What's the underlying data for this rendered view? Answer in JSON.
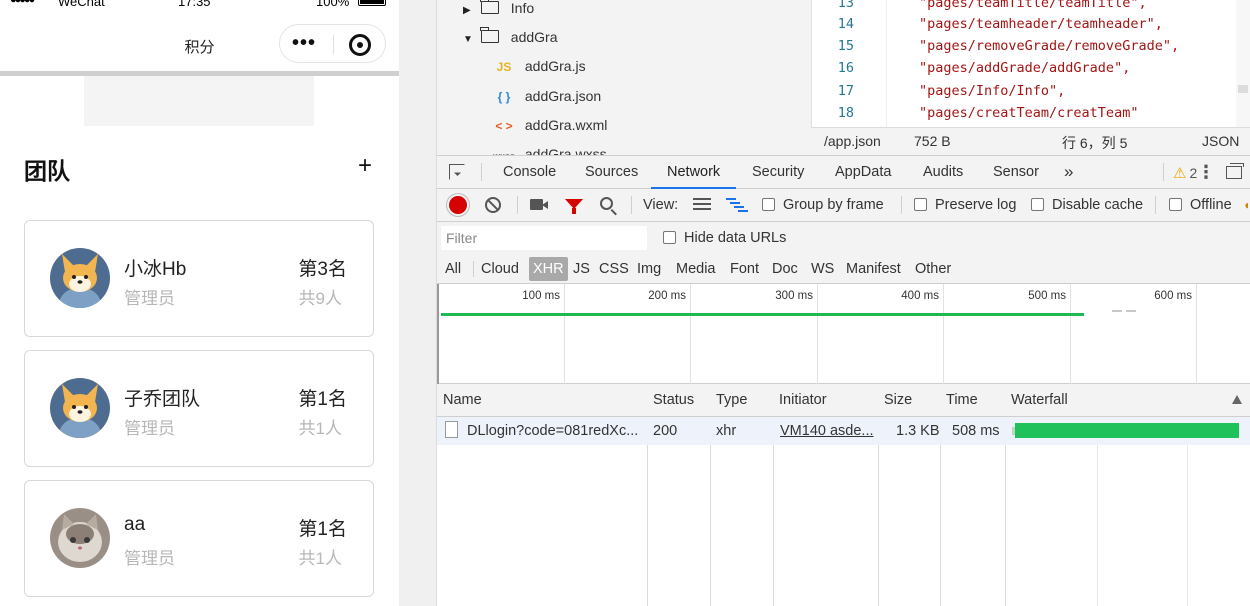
{
  "phone": {
    "status": {
      "signal": "●●●●●",
      "carrier": "WeChat",
      "time": "17:35",
      "battery_pct": "100%"
    },
    "nav": {
      "title": "积分",
      "dots": "•••"
    },
    "team_section": {
      "title": "团队",
      "add_symbol": "+"
    },
    "teams": [
      {
        "name": "小冰Hb",
        "role": "管理员",
        "rank": "第3名",
        "count": "共9人",
        "avatar": "corgi"
      },
      {
        "name": "子乔团队",
        "role": "管理员",
        "rank": "第1名",
        "count": "共1人",
        "avatar": "corgi"
      },
      {
        "name": "aa",
        "role": "管理员",
        "rank": "第1名",
        "count": "共1人",
        "avatar": "cat"
      }
    ]
  },
  "file_tree": {
    "items": [
      {
        "label": "Info",
        "kind": "folder",
        "expanded": false
      },
      {
        "label": "addGra",
        "kind": "folder",
        "expanded": true
      },
      {
        "label": "addGra.js",
        "kind": "js",
        "icon": "JS"
      },
      {
        "label": "addGra.json",
        "kind": "json",
        "icon": "{ }"
      },
      {
        "label": "addGra.wxml",
        "kind": "wxml",
        "icon": "< >"
      },
      {
        "label": "addGra.wxss",
        "kind": "wxss",
        "icon": "wxss"
      }
    ]
  },
  "editor": {
    "lines": [
      {
        "num": "13",
        "code": "\"pages/teamTitle/teamTitle\","
      },
      {
        "num": "14",
        "code": "\"pages/teamheader/teamheader\","
      },
      {
        "num": "15",
        "code": "\"pages/removeGrade/removeGrade\","
      },
      {
        "num": "16",
        "code": "\"pages/addGrade/addGrade\","
      },
      {
        "num": "17",
        "code": "\"pages/Info/Info\","
      },
      {
        "num": "18",
        "code": "\"pages/creatTeam/creatTeam\""
      }
    ],
    "status": {
      "file": "/app.json",
      "size": "752 B",
      "position": "行 6，列 5",
      "language": "JSON"
    }
  },
  "devtools": {
    "tabs": [
      "Console",
      "Sources",
      "Network",
      "Security",
      "AppData",
      "Audits",
      "Sensor"
    ],
    "active_tab": "Network",
    "more_tabs": "»",
    "warnings": "2",
    "toolbar": {
      "view_label": "View:",
      "group_by_frame": "Group by frame",
      "preserve_log": "Preserve log",
      "disable_cache": "Disable cache",
      "offline": "Offline"
    },
    "filter": {
      "placeholder": "Filter",
      "hide_data_urls": "Hide data URLs"
    },
    "types": [
      "All",
      "Cloud",
      "XHR",
      "JS",
      "CSS",
      "Img",
      "Media",
      "Font",
      "Doc",
      "WS",
      "Manifest",
      "Other"
    ],
    "active_type": "XHR",
    "overview_ticks": [
      "100 ms",
      "200 ms",
      "300 ms",
      "400 ms",
      "500 ms",
      "600 ms"
    ],
    "columns": [
      "Name",
      "Status",
      "Type",
      "Initiator",
      "Size",
      "Time",
      "Waterfall"
    ],
    "requests": [
      {
        "name": "DLlogin?code=081redXc...",
        "status": "200",
        "type": "xhr",
        "initiator": "VM140 asde...",
        "size": "1.3 KB",
        "time": "508 ms",
        "duration_ms": 508
      }
    ],
    "colors": {
      "accent": "#1a73e8",
      "record": "#d50000",
      "waterfall": "#1ec15a"
    }
  }
}
